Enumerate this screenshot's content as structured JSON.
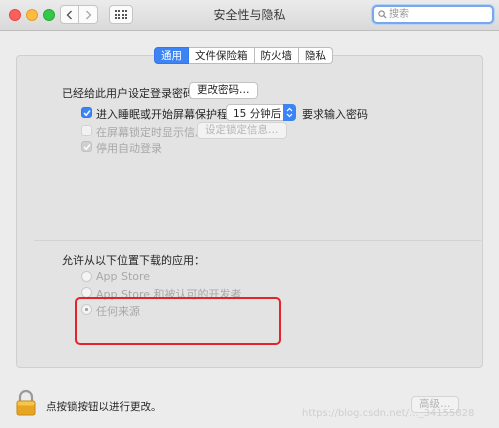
{
  "window": {
    "title": "安全性与隐私",
    "search_placeholder": "搜索"
  },
  "tabs": [
    {
      "label": "通用",
      "selected": true
    },
    {
      "label": "文件保险箱",
      "selected": false
    },
    {
      "label": "防火墙",
      "selected": false
    },
    {
      "label": "隐私",
      "selected": false
    }
  ],
  "general": {
    "password_set_label": "已经给此用户设定登录密码",
    "change_password_button": "更改密码…",
    "require_password": {
      "label": "进入睡眠或开始屏幕保护程序",
      "checked": true
    },
    "delay_select_value": "15 分钟后",
    "require_password_suffix": "要求输入密码",
    "show_message": {
      "label": "在屏幕锁定时显示信息",
      "checked": false,
      "enabled": false
    },
    "set_lock_message_button": "设定锁定信息…",
    "disable_auto_login": {
      "label": "停用自动登录",
      "checked": true,
      "enabled": false
    }
  },
  "downloads": {
    "heading": "允许从以下位置下载的应用：",
    "options": [
      {
        "label": "App Store",
        "selected": false
      },
      {
        "label": "App Store 和被认可的开发者",
        "selected": false
      },
      {
        "label": "任何来源",
        "selected": true
      }
    ]
  },
  "footer": {
    "lock_text": "点按锁按钮以进行更改。",
    "advanced_button": "高级…",
    "watermark": "https://blog.csdn.net/..._34155828"
  },
  "colors": {
    "accent": "#3c84f6",
    "highlight": "#e0252b"
  }
}
